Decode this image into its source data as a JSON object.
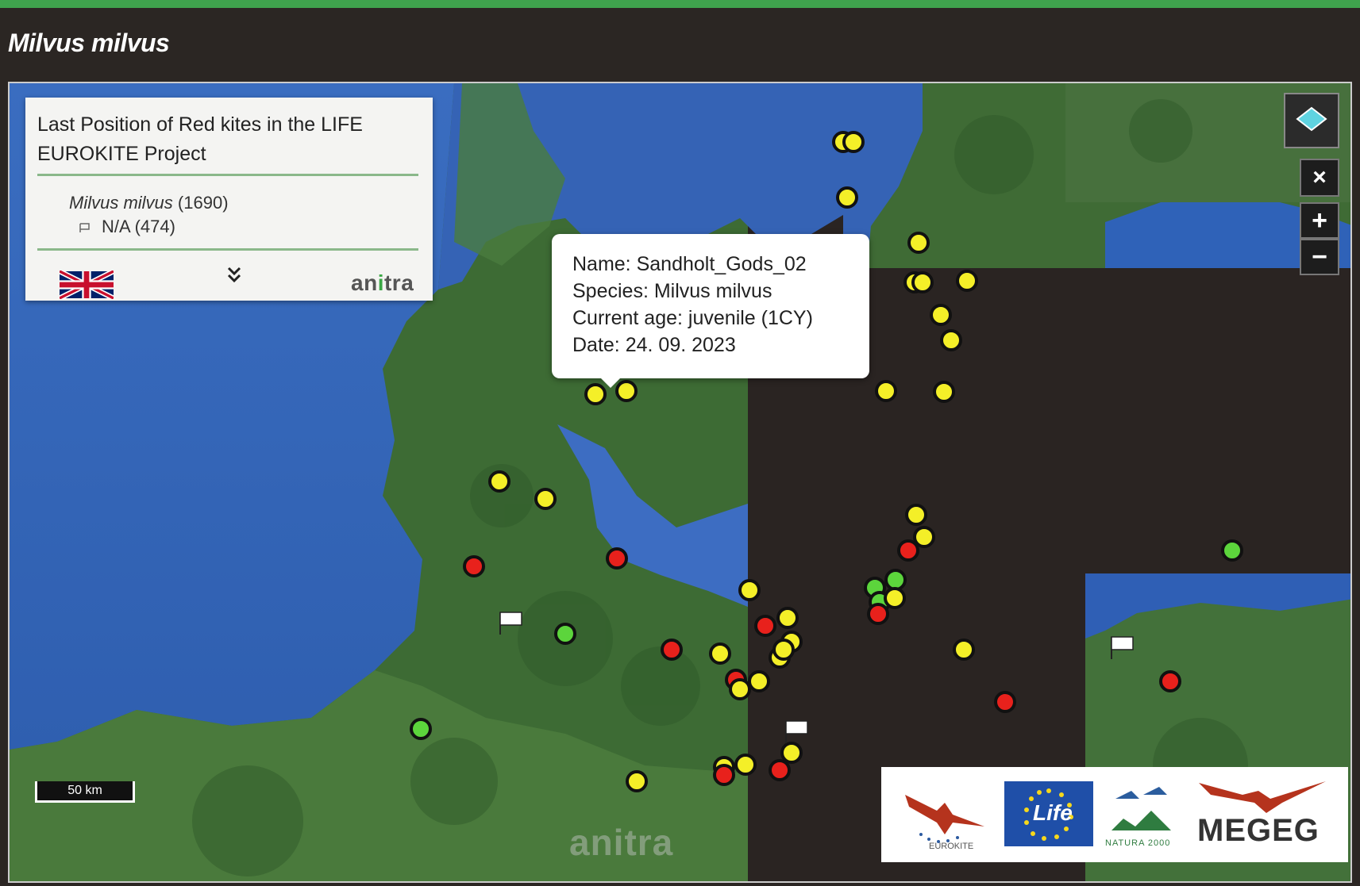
{
  "header": {
    "title": "Milvus milvus"
  },
  "legend": {
    "title": "Last Position of Red kites in the LIFE EUROKITE Project",
    "species_name": "Milvus milvus",
    "species_count": "(1690)",
    "na_label": "N/A (474)",
    "brand": "anitra"
  },
  "controls": {
    "close": "×",
    "zoom_in": "+",
    "zoom_out": "−"
  },
  "popup": {
    "name_label": "Name:",
    "name_value": "Sandholt_Gods_02",
    "species_label": "Species:",
    "species_value": "Milvus milvus",
    "age_label": "Current age:",
    "age_value": "juvenile (1CY)",
    "date_label": "Date:",
    "date_value": "24. 09. 2023"
  },
  "scale_bar": "50 km",
  "watermark": "anitra",
  "logos": {
    "eurokite": "EUROKITE",
    "life": "Life",
    "natura": "NATURA 2000",
    "megeg": "MEGEG"
  },
  "colors": {
    "accent": "#3fa34d",
    "marker_yellow": "#f4ef28",
    "marker_red": "#e8211c",
    "marker_green": "#5cd53c",
    "water": "#3b6fbf",
    "land": "#3e6d35"
  },
  "icons": [
    "layers-icon",
    "close-icon",
    "plus-icon",
    "minus-icon",
    "uk-flag-icon",
    "double-chevron-down-icon",
    "flag-icon"
  ]
}
